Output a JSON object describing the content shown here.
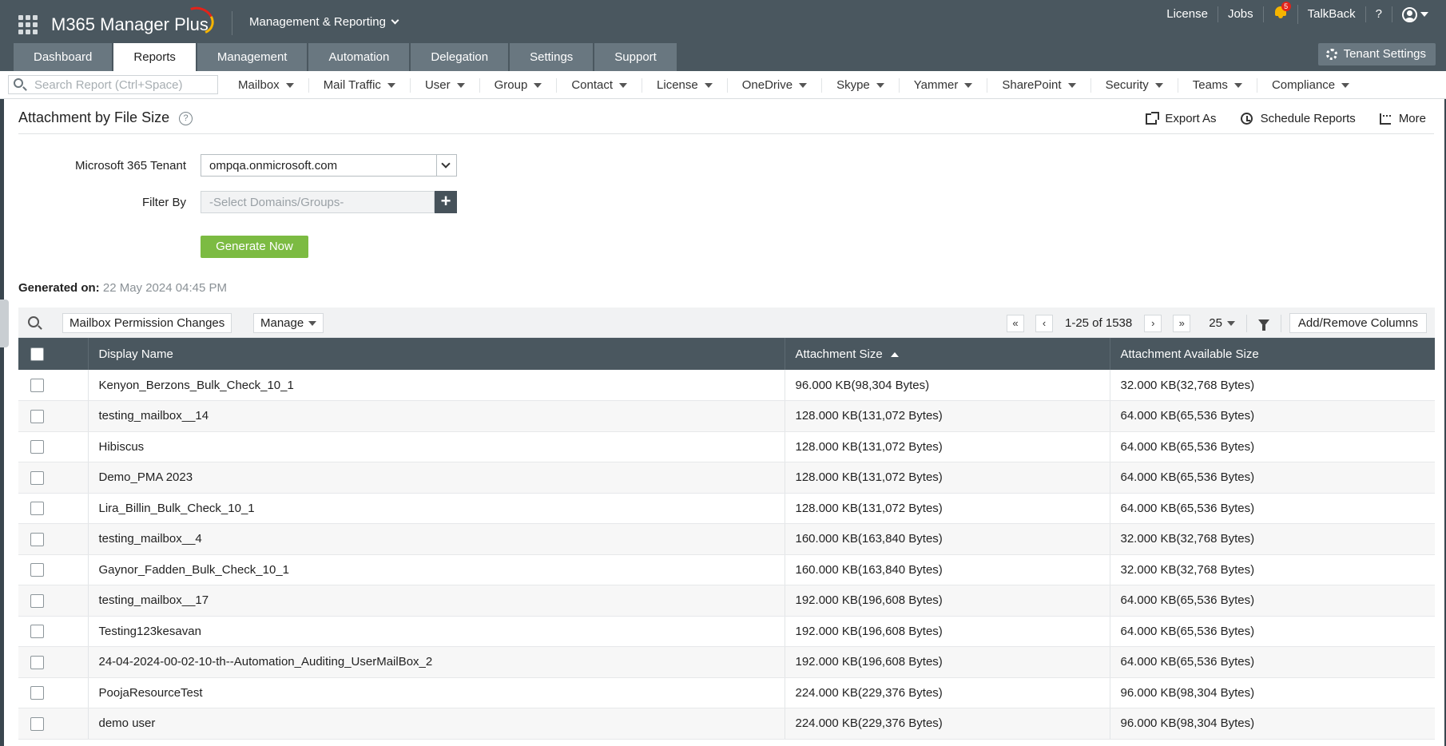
{
  "app": {
    "name": "M365 Manager Plus",
    "module": "Management & Reporting",
    "top_links": [
      "License",
      "Jobs",
      "TalkBack",
      "?"
    ],
    "notification_count": "5",
    "accent": "#7cbb42",
    "header_bg": "#4a575f"
  },
  "tabs": [
    {
      "label": "Dashboard",
      "active": false
    },
    {
      "label": "Reports",
      "active": true
    },
    {
      "label": "Management",
      "active": false
    },
    {
      "label": "Automation",
      "active": false
    },
    {
      "label": "Delegation",
      "active": false
    },
    {
      "label": "Settings",
      "active": false
    },
    {
      "label": "Support",
      "active": false
    }
  ],
  "tenant_settings_label": "Tenant Settings",
  "search": {
    "placeholder": "Search Report (Ctrl+Space)"
  },
  "categories": [
    "Mailbox",
    "Mail Traffic",
    "User",
    "Group",
    "Contact",
    "License",
    "OneDrive",
    "Skype",
    "Yammer",
    "SharePoint",
    "Security",
    "Teams",
    "Compliance"
  ],
  "report": {
    "title": "Attachment by File Size",
    "actions": {
      "export": "Export As",
      "schedule": "Schedule Reports",
      "more": "More"
    },
    "form": {
      "tenant_label": "Microsoft 365 Tenant",
      "tenant_value": "ompqa.onmicrosoft.com",
      "filter_label": "Filter By",
      "filter_placeholder": "-Select Domains/Groups-",
      "generate_label": "Generate Now"
    },
    "generated_label": "Generated on:",
    "generated_value": "22 May 2024 04:45 PM"
  },
  "toolbar": {
    "view_name": "Mailbox Permission Changes",
    "manage_label": "Manage",
    "page_range": "1-25 of 1538",
    "page_size": "25",
    "add_remove_label": "Add/Remove Columns"
  },
  "table": {
    "columns": [
      "Display Name",
      "Attachment Size",
      "Attachment Available Size"
    ],
    "rows": [
      [
        "Kenyon_Berzons_Bulk_Check_10_1",
        "96.000 KB(98,304 Bytes)",
        "32.000 KB(32,768 Bytes)"
      ],
      [
        "testing_mailbox__14",
        "128.000 KB(131,072 Bytes)",
        "64.000 KB(65,536 Bytes)"
      ],
      [
        "Hibiscus",
        "128.000 KB(131,072 Bytes)",
        "64.000 KB(65,536 Bytes)"
      ],
      [
        "Demo_PMA 2023",
        "128.000 KB(131,072 Bytes)",
        "64.000 KB(65,536 Bytes)"
      ],
      [
        "Lira_Billin_Bulk_Check_10_1",
        "128.000 KB(131,072 Bytes)",
        "64.000 KB(65,536 Bytes)"
      ],
      [
        "testing_mailbox__4",
        "160.000 KB(163,840 Bytes)",
        "32.000 KB(32,768 Bytes)"
      ],
      [
        "Gaynor_Fadden_Bulk_Check_10_1",
        "160.000 KB(163,840 Bytes)",
        "32.000 KB(32,768 Bytes)"
      ],
      [
        "testing_mailbox__17",
        "192.000 KB(196,608 Bytes)",
        "64.000 KB(65,536 Bytes)"
      ],
      [
        "Testing123kesavan",
        "192.000 KB(196,608 Bytes)",
        "64.000 KB(65,536 Bytes)"
      ],
      [
        "24-04-2024-00-02-10-th--Automation_Auditing_UserMailBox_2",
        "192.000 KB(196,608 Bytes)",
        "64.000 KB(65,536 Bytes)"
      ],
      [
        "PoojaResourceTest",
        "224.000 KB(229,376 Bytes)",
        "96.000 KB(98,304 Bytes)"
      ],
      [
        "demo user",
        "224.000 KB(229,376 Bytes)",
        "96.000 KB(98,304 Bytes)"
      ]
    ]
  }
}
